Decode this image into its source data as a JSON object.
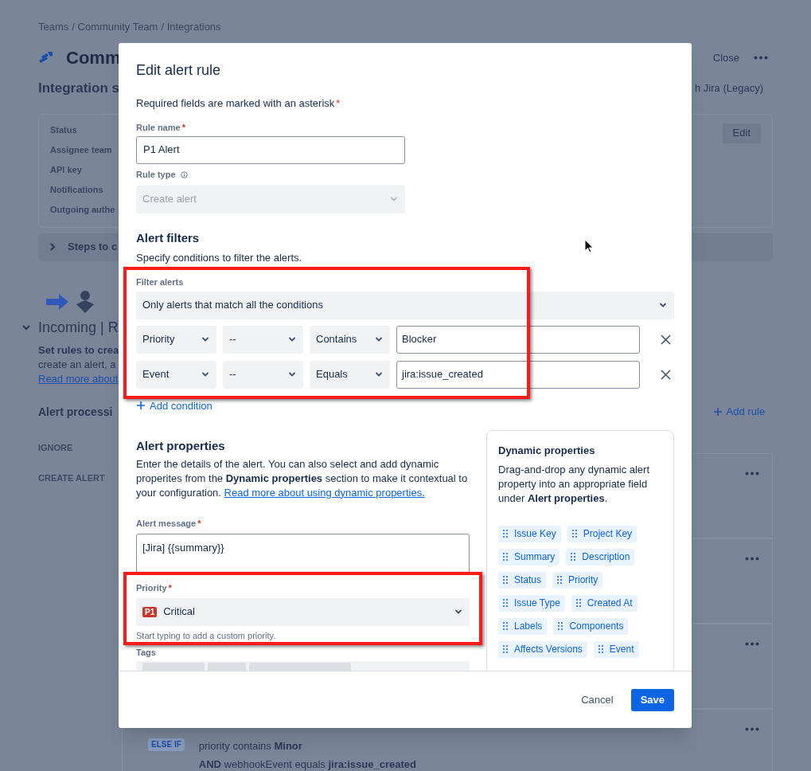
{
  "background": {
    "breadcrumbs": [
      "Teams",
      "/ Community Team",
      "/ Integrations"
    ],
    "title": "Comm",
    "close": "Close",
    "subtitle": "Integration s",
    "subtitle_right": "h Jira (Legacy)",
    "settings": {
      "labels": [
        "Status",
        "Assignee team",
        "API key",
        "Notifications",
        "Outgoing authe"
      ],
      "edit": "Edit"
    },
    "steps": "Steps to c",
    "section": {
      "title": "Incoming | R",
      "expanded": true,
      "lines": [
        {
          "text": "Set rules to crea",
          "bold": true
        },
        {
          "text": "create an alert, a",
          "bold": false
        }
      ],
      "link": "Read more about"
    },
    "processing": {
      "title": "Alert processi",
      "add_rule": "Add rule",
      "categories": [
        "IGNORE",
        "CREATE ALERT"
      ]
    },
    "rule_card": {
      "badge": "ELSE IF",
      "lines": [
        "priority contains **Minor**",
        "**AND** webhookEvent equals **jira:issue_created**"
      ]
    }
  },
  "modal": {
    "title": "Edit alert rule",
    "required_note": {
      "text": "Required fields are marked with an asterisk",
      "mark": "*"
    },
    "rule_name": {
      "label": "Rule name",
      "mark": "*",
      "value": "P1 Alert"
    },
    "rule_type": {
      "label": "Rule type",
      "value": "Create alert",
      "disabled": true
    },
    "filters": {
      "heading": "Alert filters",
      "description": "Specify conditions to filter the alerts.",
      "label": "Filter alerts",
      "mode": "Only alerts that match all the conditions",
      "conditions": [
        {
          "field": "Priority",
          "modifier": "--",
          "operator": "Contains",
          "value": "Blocker"
        },
        {
          "field": "Event",
          "modifier": "--",
          "operator": "Equals",
          "value": "jira:issue_created"
        }
      ],
      "add_condition": "Add condition"
    },
    "properties": {
      "heading": "Alert properties",
      "description": "Enter the details of the alert. You can also select and add dynamic properites from the **Dynamic properties** section to make it contextual to your configuration.",
      "link": "Read more about using dynamic properties.",
      "message": {
        "label": "Alert message",
        "mark": "*",
        "value": "[Jira] {{summary}}"
      },
      "priority": {
        "label": "Priority",
        "mark": "*",
        "badge": "P1",
        "value": "Critical",
        "help": "Start typing to add a custom priority."
      },
      "tags": {
        "label": "Tags"
      }
    },
    "dynamic": {
      "heading": "Dynamic properties",
      "description": "Drag-and-drop any dynamic alert property into an appropriate field under **Alert properties**.",
      "chips": [
        "Issue Key",
        "Project Key",
        "Summary",
        "Description",
        "Status",
        "Priority",
        "Issue Type",
        "Created At",
        "Labels",
        "Components",
        "Affects Versions",
        "Event"
      ]
    },
    "cancel": "Cancel",
    "save": "Save"
  }
}
